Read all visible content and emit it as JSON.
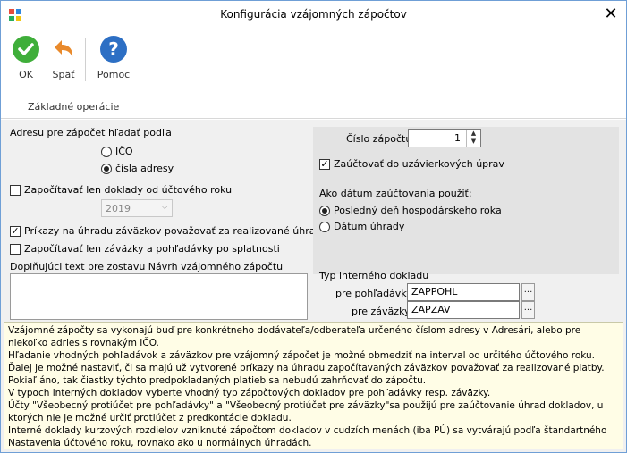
{
  "window": {
    "title": "Konfigurácia vzájomných zápočtov",
    "close_glyph": "✕"
  },
  "ribbon": {
    "ok_label": "OK",
    "back_label": "Späť",
    "help_label": "Pomoc",
    "group_label": "Základné operácie"
  },
  "left": {
    "address_heading": "Adresu pre zápočet hľadať podľa",
    "radio_ico": "IČO",
    "radio_cisla": "čísla adresy",
    "check_year": "Započítavať len doklady od účtového roku",
    "year_value": "2019",
    "check_prikazy": "Príkazy na úhradu záväzkov považovať za realizované úhrady",
    "check_splatnost": "Započítavať len záväzky a pohľadávky po splatnosti",
    "text_label": "Doplňujúci text pre zostavu Návrh vzájomného zápočtu"
  },
  "right": {
    "cislo_label": "Číslo zápočtu",
    "cislo_value": "1",
    "check_uzav": "Zaúčtovať do uzávierkových úprav",
    "datum_heading": "Ako dátum zaúčtovania použiť:",
    "radio_posledny": "Posledný deň hospodárskeho roka",
    "radio_uhrady": "Dátum úhrady",
    "typ_heading": "Typ interného dokladu",
    "pohladavky_label": "pre pohľadávky",
    "pohladavky_value": "ZAPPOHL",
    "zavazky_label": "pre záväzky",
    "zavazky_value": "ZAPZAV",
    "browse_glyph": "..."
  },
  "info": {
    "lines": [
      "Vzájomné zápočty sa vykonajú buď pre konkrétneho dodávateľa/odberateľa určeného číslom adresy v Adresári, alebo pre niekoľko adries s rovnakým IČO.",
      "Hľadanie vhodných pohľadávok a záväzkov pre vzájomný zápočet je možné obmedziť na interval od určitého účtového roku.",
      "Ďalej je možné nastaviť, či sa majú už vytvorené príkazy na úhradu započítavaných záväzkov považovať za realizované platby. Pokiaľ áno, tak čiastky týchto predpokladaných platieb sa nebudú zahrňovať do zápočtu.",
      "V typoch interných dokladov vyberte vhodný typ zápočtových dokladov pre pohľadávky resp. záväzky.",
      "Účty \"Všeobecný protiúčet pre pohľadávky\" a \"Všeobecný protiúčet pre záväzky\"sa použijú pre zaúčtovanie úhrad dokladov, u ktorých nie je možné určiť protiúčet z predkontácie dokladu.",
      "Interné doklady kurzových rozdielov vzniknuté zápočtom dokladov v cudzích menách (iba PÚ) sa vytvárajú podľa štandartného Nastavenia účtového roku, rovnako ako u normálnych úhradách."
    ]
  },
  "colors": {
    "ok_green": "#3fae3a",
    "back_orange": "#e98a2c",
    "help_blue": "#2d6fc4"
  }
}
